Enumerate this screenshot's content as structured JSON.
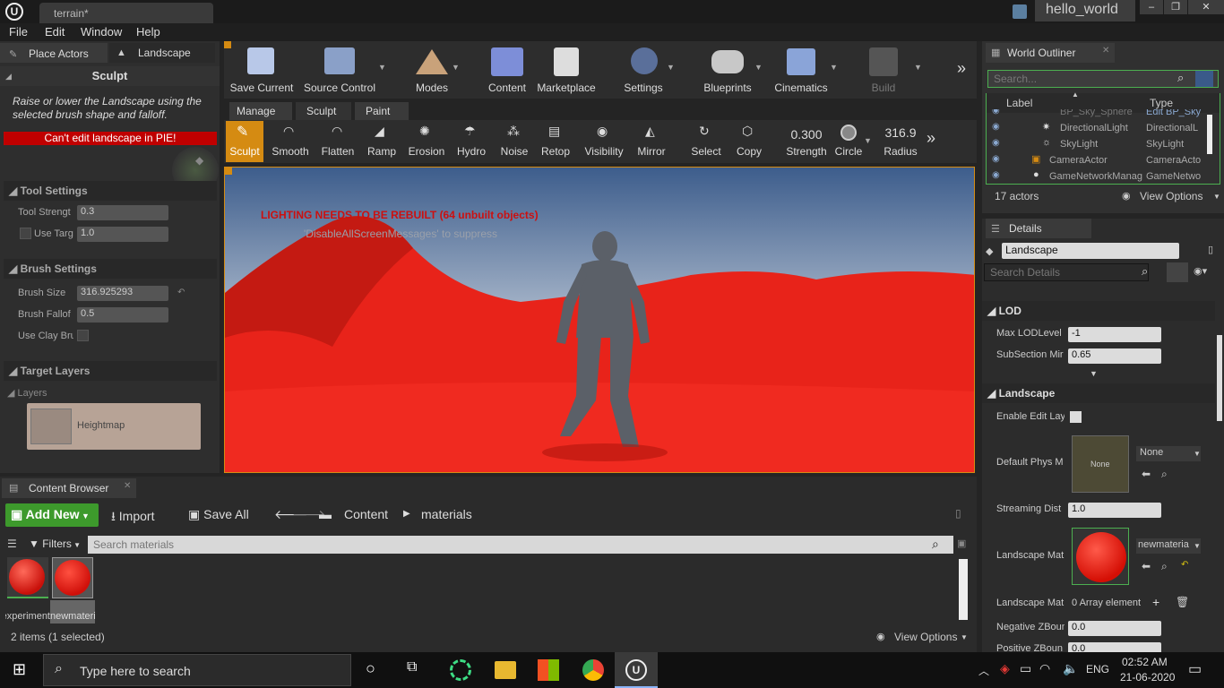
{
  "window": {
    "tab": "terrain*",
    "project": "hello_world",
    "minimize": "–",
    "maximize": "❐",
    "close": "✕"
  },
  "menu": [
    "File",
    "Edit",
    "Window",
    "Help"
  ],
  "modes_tabs": {
    "place_actors": "Place Actors",
    "landscape": "Landscape"
  },
  "mode_title": "Sculpt",
  "sculpt_desc": "Raise or lower the Landscape using the selected brush shape and falloff.",
  "pie_warning": "Can't edit landscape in PIE!",
  "tool_settings": {
    "title": "Tool Settings",
    "tool_strength_label": "Tool Strengt",
    "tool_strength": "0.3",
    "use_target_label": "Use Targ",
    "use_target": "1.0"
  },
  "brush_settings": {
    "title": "Brush Settings",
    "brush_size_label": "Brush Size",
    "brush_size": "316.925293",
    "brush_falloff_label": "Brush Fallof",
    "brush_falloff": "0.5",
    "use_clay_label": "Use Clay Bru"
  },
  "target_layers": {
    "title": "Target Layers",
    "layers_label": "Layers",
    "heightmap": "Heightmap"
  },
  "toolbar": [
    "Save Current",
    "Source Control",
    "Modes",
    "Content",
    "Marketplace",
    "Settings",
    "Blueprints",
    "Cinematics",
    "Build"
  ],
  "landscape_tabs": [
    "Manage",
    "Sculpt",
    "Paint"
  ],
  "sculpt_tools": [
    "Sculpt",
    "Smooth",
    "Flatten",
    "Ramp",
    "Erosion",
    "Hydro",
    "Noise",
    "Retop",
    "Visibility",
    "Mirror",
    "Select",
    "Copy"
  ],
  "brush_strength": {
    "value": "0.300",
    "label": "Strength"
  },
  "brush_shape": "Circle",
  "brush_radius": {
    "value": "316.9",
    "label": "Radius"
  },
  "viewport": {
    "lighting_msg": "LIGHTING NEEDS TO BE REBUILT (64 unbuilt objects)",
    "suppress_msg": "'DisableAllScreenMessages' to suppress"
  },
  "world_outliner": {
    "title": "World Outliner",
    "search_placeholder": "Search...",
    "col_label": "Label",
    "col_type": "Type",
    "rows": [
      {
        "label": "BP_Sky_Sphere",
        "type": "Edit BP_Sky"
      },
      {
        "label": "DirectionalLight",
        "type": "DirectionalL"
      },
      {
        "label": "SkyLight",
        "type": "SkyLight"
      },
      {
        "label": "CameraActor",
        "type": "CameraActo"
      },
      {
        "label": "GameNetworkManag",
        "type": "GameNetwo"
      }
    ],
    "count": "17 actors",
    "view_options": "View Options"
  },
  "details": {
    "title": "Details",
    "object_name": "Landscape",
    "search_placeholder": "Search Details",
    "lod_title": "LOD",
    "max_lod_label": "Max LODLevel",
    "max_lod": "-1",
    "subsection_label": "SubSection Mir",
    "subsection": "0.65",
    "landscape_title": "Landscape",
    "enable_edit_label": "Enable Edit Lay",
    "default_phys_label": "Default Phys M",
    "default_phys": "None",
    "default_phys_thumb": "None",
    "streaming_label": "Streaming Dist",
    "streaming": "1.0",
    "landscape_mat_label": "Landscape Mat",
    "landscape_mat": "newmateria",
    "landscape_mat2_label": "Landscape Mat",
    "array_elements": "0 Array element",
    "neg_z_label": "Negative ZBoun",
    "neg_z": "0.0",
    "pos_z_label": "Positive ZBoun",
    "pos_z": "0.0"
  },
  "content_browser": {
    "title": "Content Browser",
    "add_new": "Add New",
    "import": "Import",
    "save_all": "Save All",
    "path": [
      "Content",
      "materials"
    ],
    "filters": "Filters",
    "search_placeholder": "Search materials",
    "assets": [
      {
        "name": "experiment"
      },
      {
        "name": "newmateria"
      }
    ],
    "status": "2 items (1 selected)",
    "view_options": "View Options"
  },
  "taskbar": {
    "search_placeholder": "Type here to search",
    "lang": "ENG",
    "time": "02:52 AM",
    "date": "21-06-2020"
  },
  "colors": {
    "accent": "#d58b12",
    "warning": "#c00000",
    "add_new": "#3d9a2c",
    "lighting_text": "#cc1010",
    "terrain": "#e8231a"
  }
}
